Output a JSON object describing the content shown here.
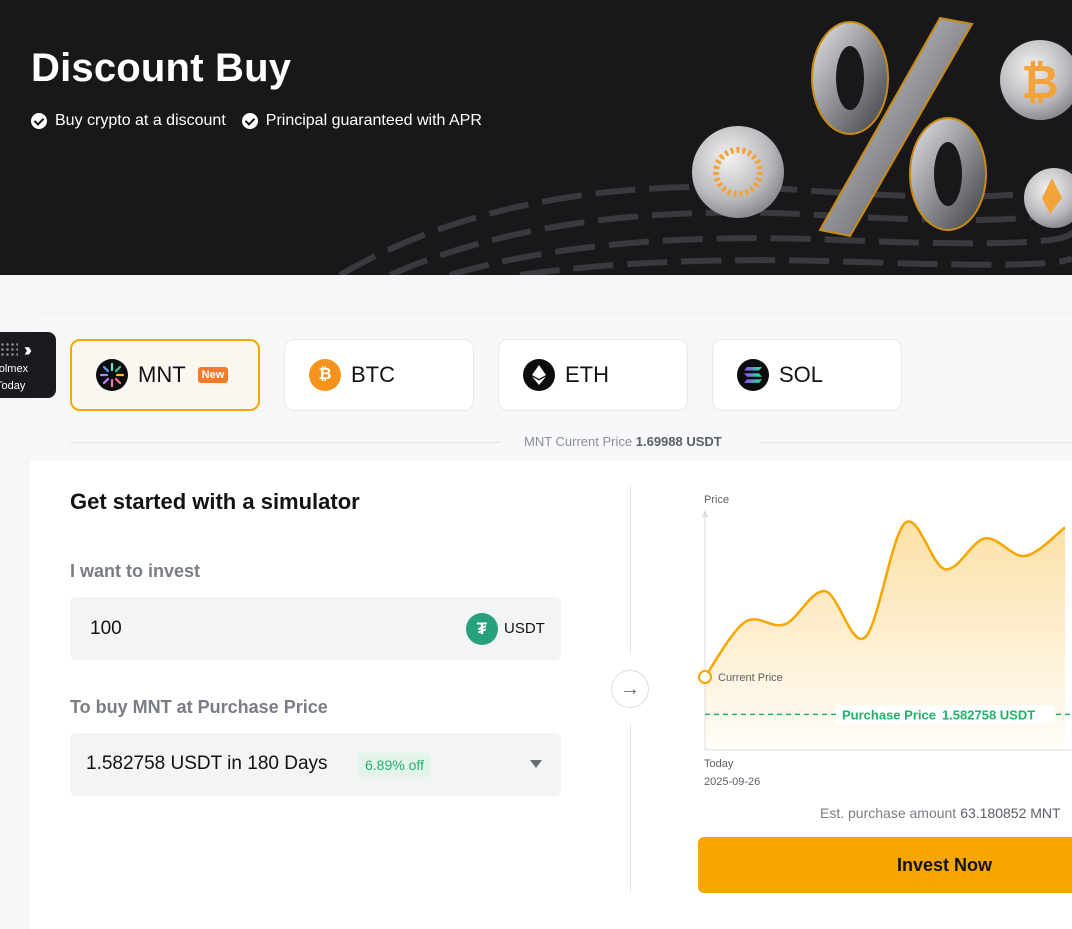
{
  "hero": {
    "title": "Discount Buy",
    "features": [
      "Buy crypto at a discount",
      "Principal guaranteed with APR"
    ]
  },
  "side_badge": {
    "brand_line1": "Volmex",
    "brand_line2": "Today"
  },
  "tabs": [
    {
      "label": "MNT",
      "badge": "New",
      "active": true,
      "icon": "mnt-icon"
    },
    {
      "label": "BTC",
      "active": false,
      "icon": "btc-icon"
    },
    {
      "label": "ETH",
      "active": false,
      "icon": "eth-icon"
    },
    {
      "label": "SOL",
      "active": false,
      "icon": "sol-icon"
    }
  ],
  "current_price": {
    "label": "MNT Current Price",
    "value": "1.69988 USDT"
  },
  "simulator": {
    "title": "Get started with a simulator",
    "invest_label": "I want to invest",
    "invest_value": "100",
    "invest_unit": "USDT",
    "purchase_label": "To buy MNT at Purchase Price",
    "purchase_option": "1.582758 USDT in 180 Days",
    "discount": "6.89% off"
  },
  "chart_data": {
    "type": "area",
    "ylabel": "Price",
    "x_start_label": "Today",
    "x_start_date": "2025-09-26",
    "current_price_label": "Current Price",
    "purchase_price_label": "Purchase Price",
    "purchase_price_value": "1.582758 USDT",
    "line_color": "#f7a600",
    "purchase_line_color": "#20b26c",
    "series": [
      {
        "values": [
          0.0,
          0.25,
          0.24,
          0.39,
          0.18,
          0.7,
          0.49,
          0.63,
          0.55,
          0.68
        ]
      }
    ],
    "purchase_level": -0.17
  },
  "estimate": {
    "label": "Est. purchase amount",
    "value": "63.180852 MNT"
  },
  "invest_button": "Invest Now"
}
